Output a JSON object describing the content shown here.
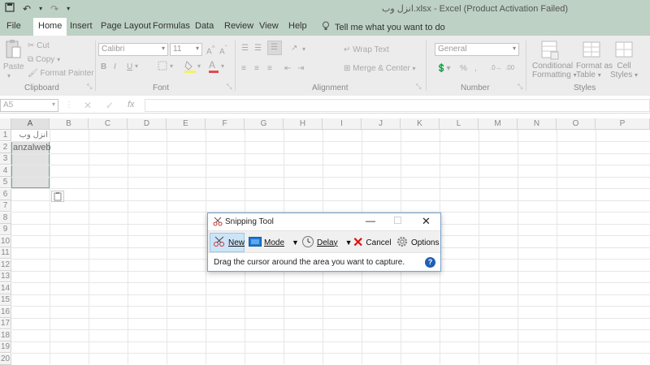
{
  "titlebar": {
    "save_icon": "save-icon",
    "undo_icon": "undo-icon",
    "redo_icon": "redo-icon",
    "customize_icon": "chevron-down-icon",
    "title": "انزل وب.xlsx  -  Excel (Product Activation Failed)"
  },
  "tabs": [
    "File",
    "Home",
    "Insert",
    "Page Layout",
    "Formulas",
    "Data",
    "Review",
    "View",
    "Help"
  ],
  "tell_me": "Tell me what you want to do",
  "clipboard": {
    "paste": "Paste",
    "cut": "Cut",
    "copy": "Copy",
    "format_painter": "Format Painter",
    "label": "Clipboard"
  },
  "font": {
    "name": "Calibri",
    "size": "11",
    "label": "Font"
  },
  "alignment": {
    "wrap": "Wrap Text",
    "merge": "Merge & Center",
    "label": "Alignment"
  },
  "number": {
    "format": "General",
    "label": "Number"
  },
  "styles": {
    "conditional": "Conditional",
    "conditional2": "Formatting",
    "format_as": "Format as",
    "format_as2": "Table",
    "cell": "Cell",
    "cell2": "Styles",
    "label": "Styles"
  },
  "formula_bar": {
    "name_box": "A5",
    "fx": "fx"
  },
  "columns": [
    "A",
    "B",
    "C",
    "D",
    "E",
    "F",
    "G",
    "H",
    "I",
    "J",
    "K",
    "L",
    "M",
    "N",
    "O",
    "P"
  ],
  "rows": [
    "1",
    "2",
    "3",
    "4",
    "5",
    "6",
    "7",
    "8",
    "9",
    "10",
    "11",
    "12",
    "13",
    "14",
    "15",
    "16",
    "17",
    "18",
    "19",
    "20"
  ],
  "cells": {
    "a1": "انزل وب",
    "a2": "anzalweb"
  },
  "snipping": {
    "title": "Snipping Tool",
    "new": "New",
    "mode": "Mode",
    "delay": "Delay",
    "cancel": "Cancel",
    "options": "Options",
    "message": "Drag the cursor around the area you want to capture.",
    "help": "?"
  }
}
